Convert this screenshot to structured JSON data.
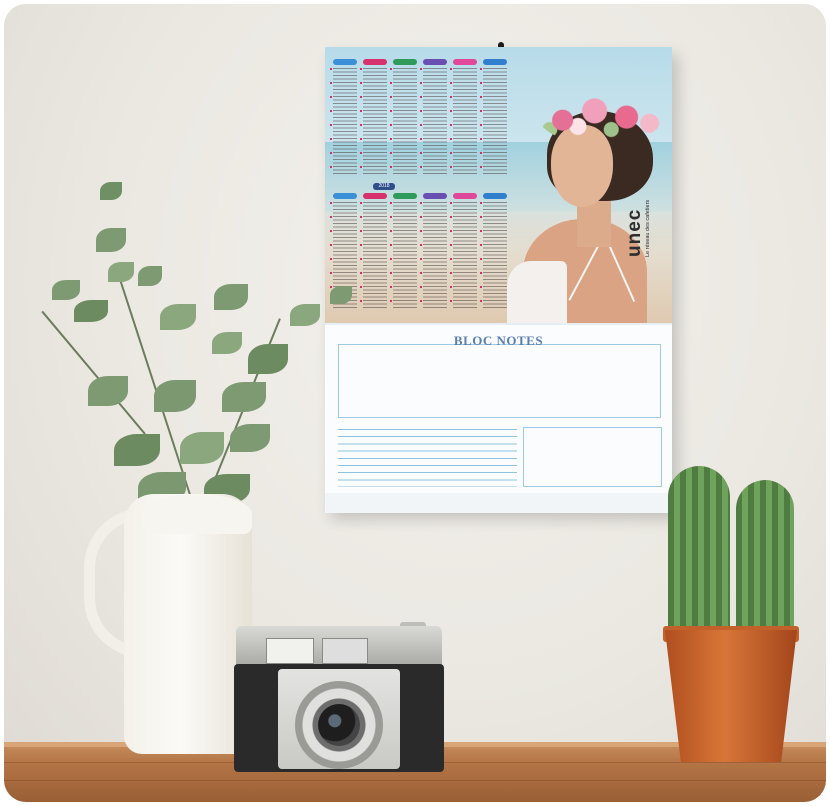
{
  "scene": {
    "calendar": {
      "brand": "unec",
      "brand_tagline": "Le réseau des cafetiers",
      "year_tag": "2018",
      "notes_title": "BLOC NOTES"
    },
    "month_header_colors": [
      "#3a8fd6",
      "#d6306d",
      "#2e9b5b",
      "#6a4fb3",
      "#e0489a",
      "#2f7fcc"
    ],
    "objects": [
      "calendar",
      "pitcher-with-eucalyptus",
      "vintage-camera",
      "potted-cactus",
      "wooden-shelf"
    ],
    "colors": {
      "wall": "#ebe8e2",
      "shelf": "#b47546",
      "notes_accent": "#5a7fae",
      "pot": "#d87638"
    }
  }
}
